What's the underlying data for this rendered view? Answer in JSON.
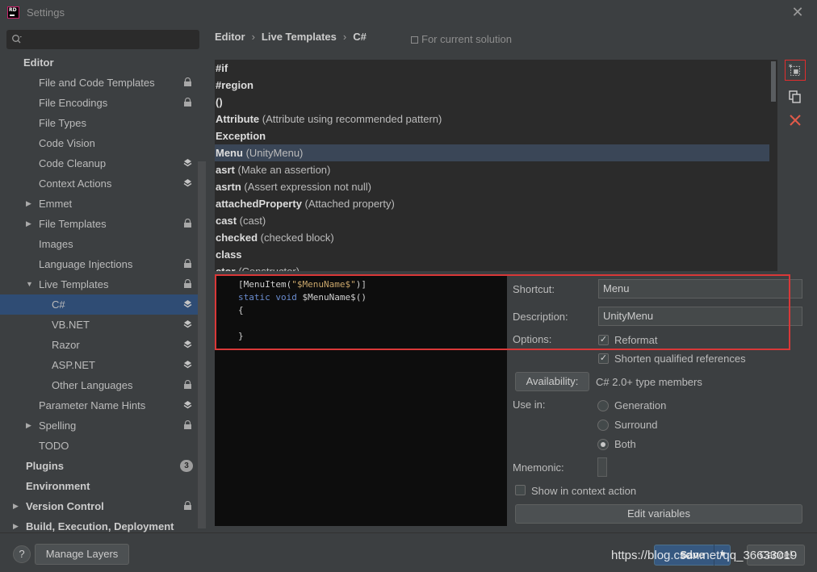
{
  "window": {
    "title": "Settings"
  },
  "search": {
    "placeholder": ""
  },
  "sidebar": {
    "items": [
      {
        "label": "Editor",
        "bold": true
      },
      {
        "label": "File and Code Templates",
        "right": "lock"
      },
      {
        "label": "File Encodings",
        "right": "lock"
      },
      {
        "label": "File Types"
      },
      {
        "label": "Code Vision"
      },
      {
        "label": "Code Cleanup",
        "right": "layers"
      },
      {
        "label": "Context Actions",
        "right": "layers"
      },
      {
        "label": "Emmet",
        "arrow": "collapsed"
      },
      {
        "label": "File Templates",
        "arrow": "collapsed",
        "right": "lock"
      },
      {
        "label": "Images"
      },
      {
        "label": "Language Injections",
        "right": "lock"
      },
      {
        "label": "Live Templates",
        "arrow": "expanded",
        "right": "lock"
      },
      {
        "label": "C#",
        "right": "layers",
        "selected": true
      },
      {
        "label": "VB.NET",
        "right": "layers"
      },
      {
        "label": "Razor",
        "right": "layers"
      },
      {
        "label": "ASP.NET",
        "right": "layers"
      },
      {
        "label": "Other Languages",
        "right": "lock"
      },
      {
        "label": "Parameter Name Hints",
        "right": "layers"
      },
      {
        "label": "Spelling",
        "arrow": "collapsed",
        "right": "lock"
      },
      {
        "label": "TODO"
      },
      {
        "label": "Plugins",
        "bold": true,
        "badge": "3"
      },
      {
        "label": "Environment",
        "bold": true
      },
      {
        "label": "Version Control",
        "bold": true,
        "arrow": "collapsed",
        "right": "lock"
      },
      {
        "label": "Build, Execution, Deployment",
        "bold": true,
        "arrow": "collapsed"
      }
    ]
  },
  "breadcrumb": {
    "part1": "Editor",
    "part2": "Live Templates",
    "part3": "C#",
    "sep": "›"
  },
  "scope": {
    "label": "For current solution"
  },
  "templates": [
    {
      "name": "#if",
      "desc": ""
    },
    {
      "name": "#region",
      "desc": ""
    },
    {
      "name": "()",
      "desc": ""
    },
    {
      "name": "Attribute",
      "desc": "(Attribute using recommended pattern)"
    },
    {
      "name": "Exception",
      "desc": ""
    },
    {
      "name": "Menu",
      "desc": "(UnityMenu)",
      "selected": true
    },
    {
      "name": "asrt",
      "desc": "(Make an assertion)"
    },
    {
      "name": "asrtn",
      "desc": "(Assert expression not null)"
    },
    {
      "name": "attachedProperty",
      "desc": "(Attached property)"
    },
    {
      "name": "cast",
      "desc": "(cast)"
    },
    {
      "name": "checked",
      "desc": "(checked block)"
    },
    {
      "name": "class",
      "desc": ""
    },
    {
      "name": "ctor",
      "desc": "(Constructor)"
    }
  ],
  "editor": {
    "line1_a": "[MenuItem(",
    "line1_str": "\"$MenuName$\"",
    "line1_b": ")]",
    "line2_kw": "static void",
    "line2_rest": " $MenuName$()",
    "line3": "{",
    "line4": "",
    "line5": "}"
  },
  "options": {
    "shortcut_label": "Shortcut:",
    "shortcut_value": "Menu",
    "description_label": "Description:",
    "description_value": "UnityMenu",
    "options_label": "Options:",
    "reformat_label": "Reformat",
    "reformat_checked": true,
    "shorten_label": "Shorten qualified references",
    "shorten_checked": true,
    "availability_button": "Availability:",
    "availability_value": "C# 2.0+ type members",
    "use_in_label": "Use in:",
    "generation_label": "Generation",
    "surround_label": "Surround",
    "both_label": "Both",
    "use_in_selected": "Both",
    "mnemonic_label": "Mnemonic:",
    "mnemonic_value": "",
    "context_action_label": "Show in context action",
    "context_action_checked": false,
    "edit_variables_button": "Edit variables"
  },
  "footer": {
    "help": "?",
    "manage_layers": "Manage Layers",
    "save": "Save",
    "cancel": "Cancel",
    "watermark": "https://blog.csdn.net/qq_36633019"
  },
  "colors": {
    "accent": "#365880",
    "selection": "#2f4c74",
    "highlight_box": "#d93838"
  }
}
